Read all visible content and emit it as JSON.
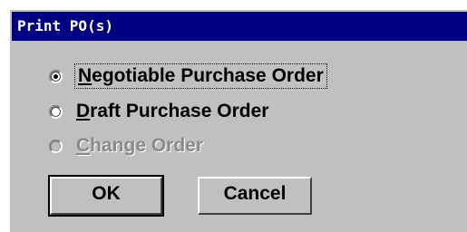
{
  "window": {
    "title": "Print PO(s)"
  },
  "options": [
    {
      "label_prefix": "",
      "label_underline": "N",
      "label_rest": "egotiable Purchase Order",
      "checked": true,
      "enabled": true
    },
    {
      "label_prefix": "",
      "label_underline": "D",
      "label_rest": "raft Purchase Order",
      "checked": false,
      "enabled": true
    },
    {
      "label_prefix": "",
      "label_underline": "C",
      "label_rest": "hange Order",
      "checked": false,
      "enabled": false
    }
  ],
  "buttons": {
    "ok_label": "OK",
    "cancel_label": "Cancel"
  },
  "colors": {
    "titlebar": "#000080",
    "dialog_bg": "#c0c0c0"
  }
}
